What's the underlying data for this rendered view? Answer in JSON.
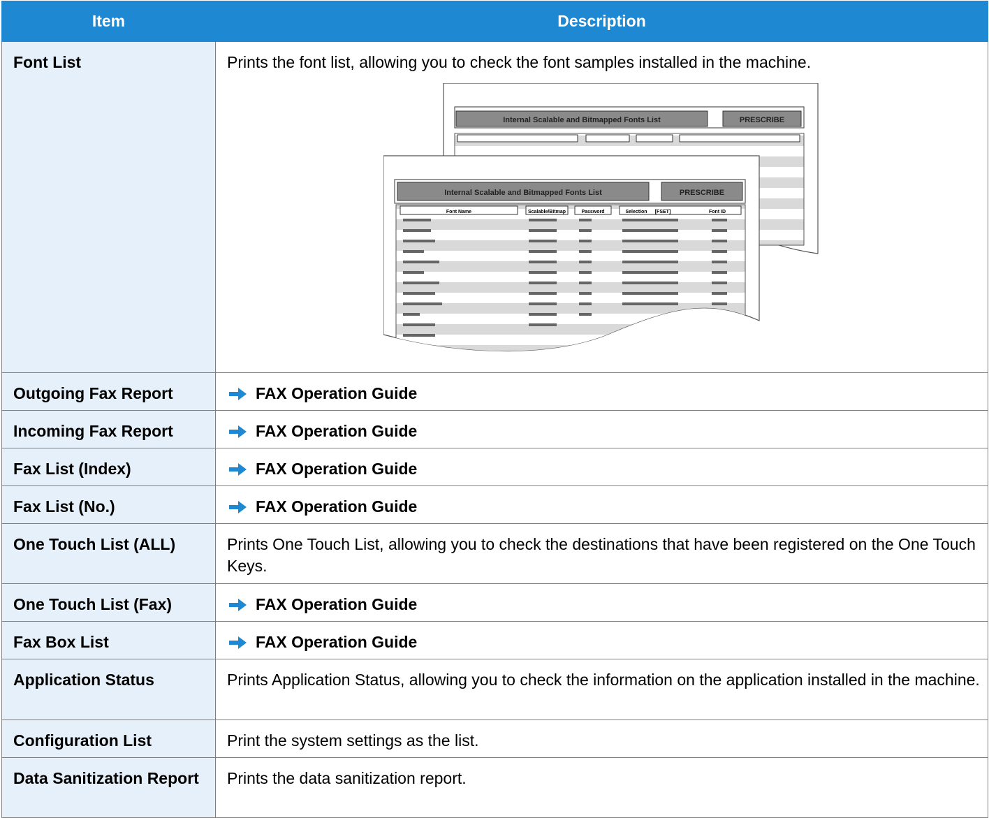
{
  "header": {
    "item": "Item",
    "description": "Description"
  },
  "rows": [
    {
      "item": "Font List",
      "desc": "Prints the font list, allowing you to check the font samples installed in the machine.",
      "kind": "text"
    },
    {
      "item": "Outgoing Fax Report",
      "desc": "FAX Operation Guide",
      "kind": "ref"
    },
    {
      "item": "Incoming Fax Report",
      "desc": "FAX Operation Guide",
      "kind": "ref"
    },
    {
      "item": "Fax List (Index)",
      "desc": "FAX Operation Guide",
      "kind": "ref"
    },
    {
      "item": "Fax List (No.)",
      "desc": "FAX Operation Guide",
      "kind": "ref"
    },
    {
      "item": "One Touch List (ALL)",
      "desc": "Prints One Touch List, allowing you to check the destinations that have been registered on the One Touch Keys.",
      "kind": "text"
    },
    {
      "item": "One Touch List (Fax)",
      "desc": "FAX Operation Guide",
      "kind": "ref"
    },
    {
      "item": "Fax Box List",
      "desc": "FAX Operation Guide",
      "kind": "ref"
    },
    {
      "item": "Application Status",
      "desc": "Prints Application Status, allowing you to check the information on the application installed in the machine.",
      "kind": "text"
    },
    {
      "item": "Configuration List",
      "desc": "Print the system settings as the list.",
      "kind": "text"
    },
    {
      "item": "Data Sanitization Report",
      "desc": "Prints the data sanitization report.",
      "kind": "text"
    }
  ],
  "sample_sheet": {
    "title": "Internal Scalable and Bitmapped Fonts List",
    "brand": "PRESCRIBE",
    "columns": [
      "Font Name",
      "Scalable/Bitmap",
      "Password",
      "Selection",
      "[FSET]",
      "Font ID"
    ]
  },
  "colors": {
    "header_bg": "#1e88d2",
    "item_bg": "#e6f0fa",
    "arrow": "#1e88d2"
  }
}
